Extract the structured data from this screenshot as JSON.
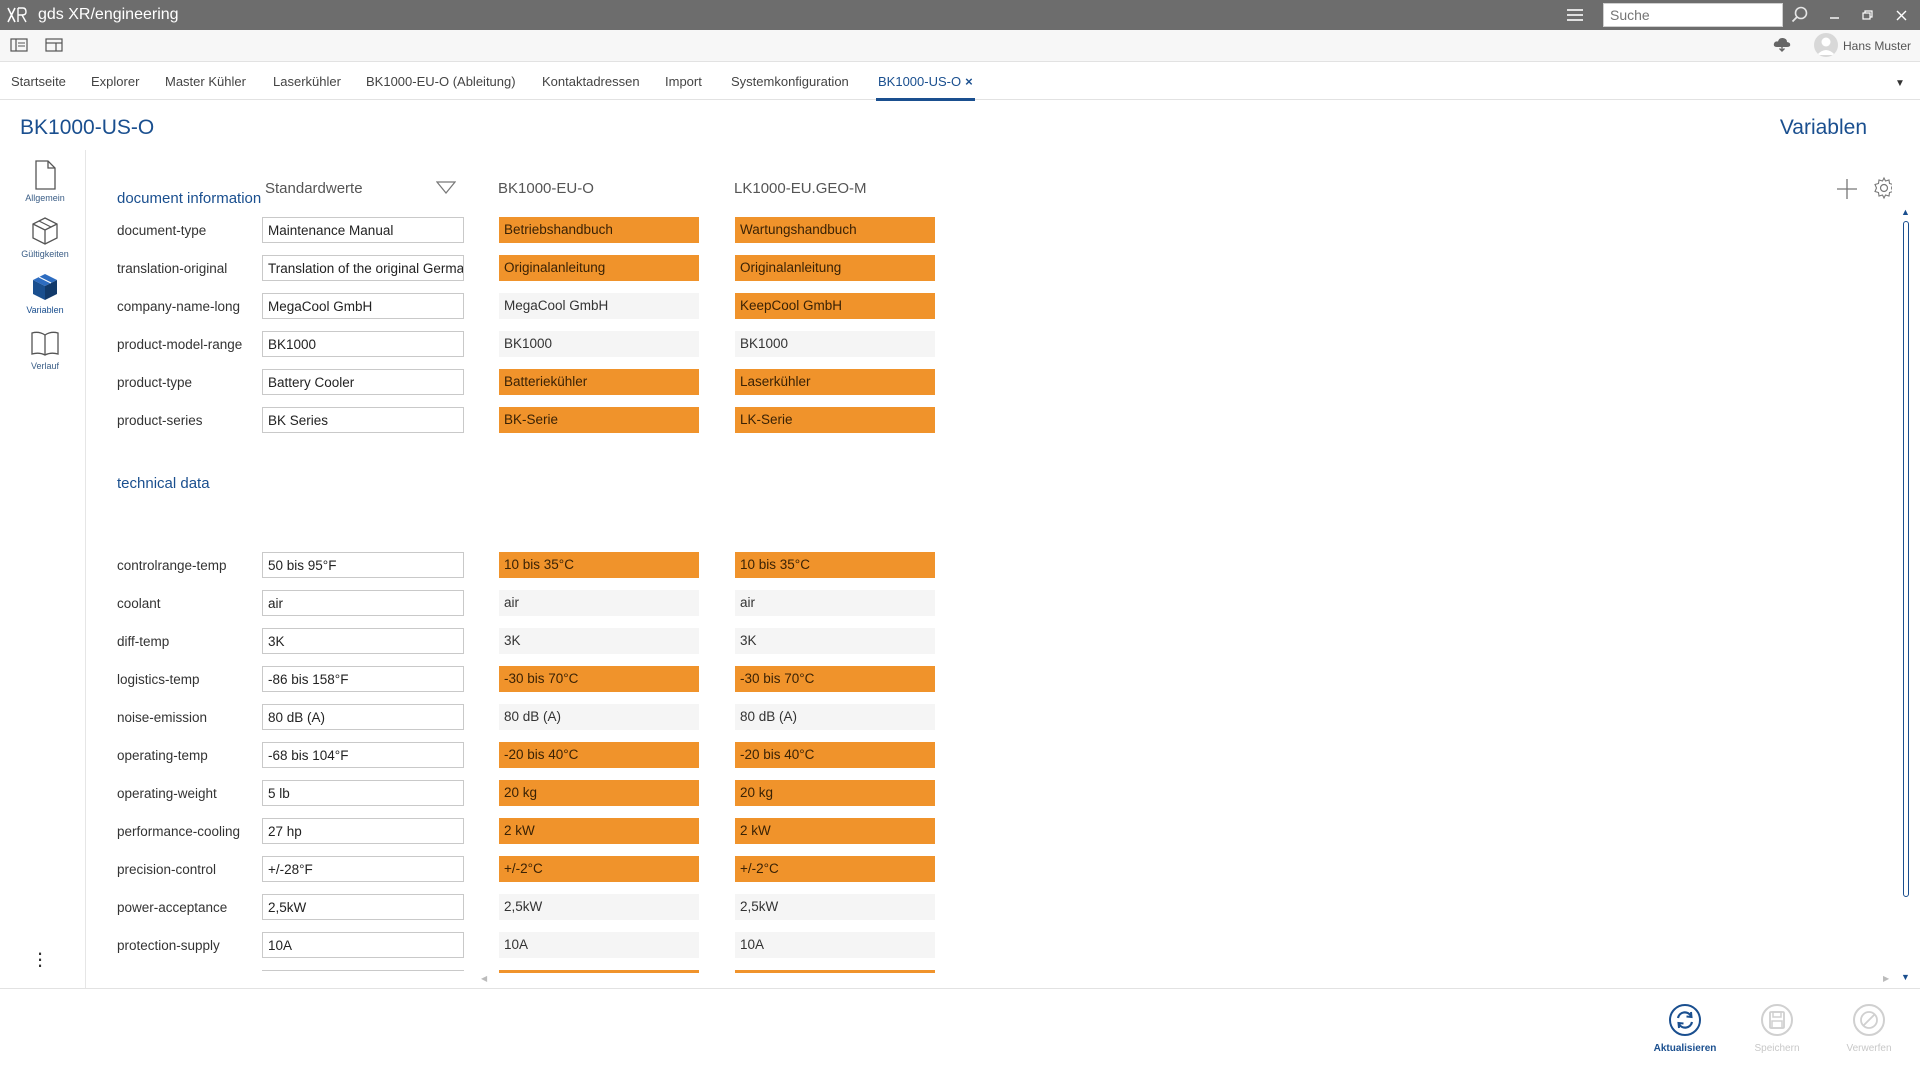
{
  "app": {
    "title": "gds XR/engineering",
    "logo_text": "XR",
    "search_placeholder": "Suche",
    "user_name": "Hans Muster"
  },
  "tabs": [
    {
      "label": "Startseite"
    },
    {
      "label": "Explorer"
    },
    {
      "label": "Master Kühler"
    },
    {
      "label": "Laserkühler"
    },
    {
      "label": "BK1000-EU-O (Ableitung)"
    },
    {
      "label": "Kontaktadressen"
    },
    {
      "label": "Import"
    },
    {
      "label": "Systemkonfiguration"
    },
    {
      "label": "BK1000-US-O",
      "active": true,
      "close": "×"
    }
  ],
  "page": {
    "title": "BK1000-US-O",
    "section_title": "Variablen"
  },
  "nav": [
    {
      "label": "Allgemein",
      "icon": "document-icon"
    },
    {
      "label": "Gültigkeiten",
      "icon": "box-outline-icon"
    },
    {
      "label": "Variablen",
      "icon": "box-filled-icon",
      "active": true
    },
    {
      "label": "Verlauf",
      "icon": "book-icon"
    }
  ],
  "columns": {
    "standard": "Standardwerte",
    "variant1": "BK1000-EU-O",
    "variant2": "LK1000-EU.GEO-M"
  },
  "groups": [
    {
      "title": "document information",
      "rows": [
        {
          "name": "document-type",
          "std": "Maintenance Manual",
          "v1": "Betriebshandbuch",
          "v1_diff": true,
          "v2": "Wartungshandbuch",
          "v2_diff": true
        },
        {
          "name": "translation-original",
          "std": "Translation of the original German",
          "v1": "Originalanleitung",
          "v1_diff": true,
          "v2": "Originalanleitung",
          "v2_diff": true
        },
        {
          "name": "company-name-long",
          "std": "MegaCool GmbH",
          "v1": "MegaCool GmbH",
          "v1_diff": false,
          "v2": "KeepCool GmbH",
          "v2_diff": true
        },
        {
          "name": "product-model-range",
          "std": "BK1000",
          "v1": "BK1000",
          "v1_diff": false,
          "v2": "BK1000",
          "v2_diff": false
        },
        {
          "name": "product-type",
          "std": "Battery Cooler",
          "v1": "Batteriekühler",
          "v1_diff": true,
          "v2": "Laserkühler",
          "v2_diff": true
        },
        {
          "name": "product-series",
          "std": "BK Series",
          "v1": "BK-Serie",
          "v1_diff": true,
          "v2": "LK-Serie",
          "v2_diff": true
        }
      ]
    },
    {
      "title": "technical data",
      "rows": [
        {
          "name": "controlrange-temp",
          "std": "50 bis 95°F",
          "v1": "10 bis 35°C",
          "v1_diff": true,
          "v2": "10 bis 35°C",
          "v2_diff": true
        },
        {
          "name": "coolant",
          "std": "air",
          "v1": "air",
          "v1_diff": false,
          "v2": "air",
          "v2_diff": false
        },
        {
          "name": "diff-temp",
          "std": "3K",
          "v1": "3K",
          "v1_diff": false,
          "v2": "3K",
          "v2_diff": false
        },
        {
          "name": "logistics-temp",
          "std": "-86 bis 158°F",
          "v1": "-30 bis 70°C",
          "v1_diff": true,
          "v2": "-30 bis 70°C",
          "v2_diff": true
        },
        {
          "name": "noise-emission",
          "std": "80 dB (A)",
          "v1": "80 dB (A)",
          "v1_diff": false,
          "v2": "80 dB (A)",
          "v2_diff": false
        },
        {
          "name": "operating-temp",
          "std": "-68 bis 104°F",
          "v1": "-20 bis 40°C",
          "v1_diff": true,
          "v2": "-20 bis 40°C",
          "v2_diff": true
        },
        {
          "name": "operating-weight",
          "std": "5 lb",
          "v1": "20 kg",
          "v1_diff": true,
          "v2": "20 kg",
          "v2_diff": true
        },
        {
          "name": "performance-cooling",
          "std": "27 hp",
          "v1": "2 kW",
          "v1_diff": true,
          "v2": "2 kW",
          "v2_diff": true
        },
        {
          "name": "precision-control",
          "std": "+/-28°F",
          "v1": "+/-2°C",
          "v1_diff": true,
          "v2": "+/-2°C",
          "v2_diff": true
        },
        {
          "name": "power-acceptance",
          "std": "2,5kW",
          "v1": "2,5kW",
          "v1_diff": false,
          "v2": "2,5kW",
          "v2_diff": false
        },
        {
          "name": "protection-supply",
          "std": "10A",
          "v1": "10A",
          "v1_diff": false,
          "v2": "10A",
          "v2_diff": false
        }
      ]
    }
  ],
  "actions": [
    {
      "label": "Aktualisieren",
      "enabled": true,
      "icon": "refresh-icon"
    },
    {
      "label": "Speichern",
      "enabled": false,
      "icon": "save-icon"
    },
    {
      "label": "Verwerfen",
      "enabled": false,
      "icon": "discard-icon"
    }
  ],
  "colors": {
    "accent": "#1a4f8f",
    "diff": "#f0932b",
    "same": "#f5f5f5",
    "titlebar": "#6d6d6d"
  }
}
